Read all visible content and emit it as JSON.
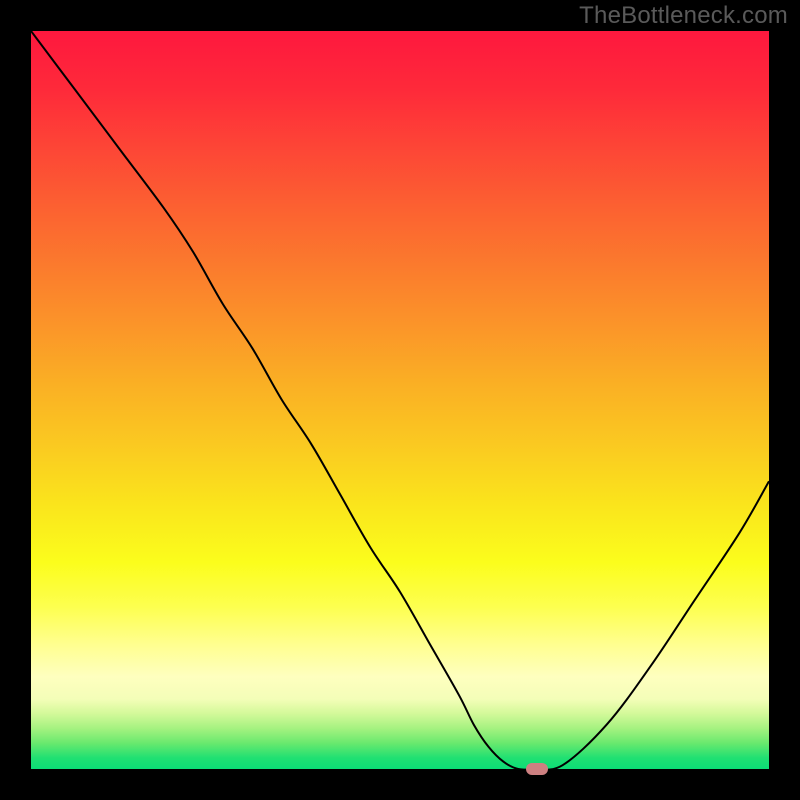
{
  "watermark": "TheBottleneck.com",
  "colors": {
    "frame": "#000000",
    "watermark": "#5a5a5a",
    "curve": "#000000",
    "marker": "#cd8081",
    "gradient_stops": [
      {
        "offset": 0.0,
        "color": "#fe183e"
      },
      {
        "offset": 0.08,
        "color": "#fe2a3a"
      },
      {
        "offset": 0.16,
        "color": "#fd4636"
      },
      {
        "offset": 0.24,
        "color": "#fc6131"
      },
      {
        "offset": 0.32,
        "color": "#fb7b2d"
      },
      {
        "offset": 0.4,
        "color": "#fb9529"
      },
      {
        "offset": 0.48,
        "color": "#fab024"
      },
      {
        "offset": 0.56,
        "color": "#fac921"
      },
      {
        "offset": 0.64,
        "color": "#fae41c"
      },
      {
        "offset": 0.72,
        "color": "#fbfd1c"
      },
      {
        "offset": 0.78,
        "color": "#fdff4f"
      },
      {
        "offset": 0.83,
        "color": "#ffff8e"
      },
      {
        "offset": 0.875,
        "color": "#feffbf"
      },
      {
        "offset": 0.905,
        "color": "#f4feb8"
      },
      {
        "offset": 0.925,
        "color": "#d3f99a"
      },
      {
        "offset": 0.945,
        "color": "#a5f280"
      },
      {
        "offset": 0.965,
        "color": "#69e96e"
      },
      {
        "offset": 0.985,
        "color": "#20e072"
      },
      {
        "offset": 1.0,
        "color": "#0bdd76"
      }
    ]
  },
  "chart_data": {
    "type": "line",
    "title": "",
    "xlabel": "",
    "ylabel": "",
    "xlim": [
      0,
      100
    ],
    "ylim": [
      0,
      100
    ],
    "grid": false,
    "legend": false,
    "series": [
      {
        "name": "bottleneck-curve",
        "x": [
          0,
          6,
          12,
          18,
          22,
          26,
          30,
          34,
          38,
          42,
          46,
          50,
          54,
          58,
          60,
          62,
          64,
          66,
          68,
          72,
          78,
          84,
          90,
          96,
          100
        ],
        "y": [
          100,
          92,
          84,
          76,
          70,
          63,
          57,
          50,
          44,
          37,
          30,
          24,
          17,
          10,
          6,
          3,
          1,
          0,
          0,
          0.5,
          6,
          14,
          23,
          32,
          39
        ]
      }
    ],
    "flat_region_x": [
      64,
      70
    ],
    "marker": {
      "x": 68.5,
      "y": 0
    }
  }
}
